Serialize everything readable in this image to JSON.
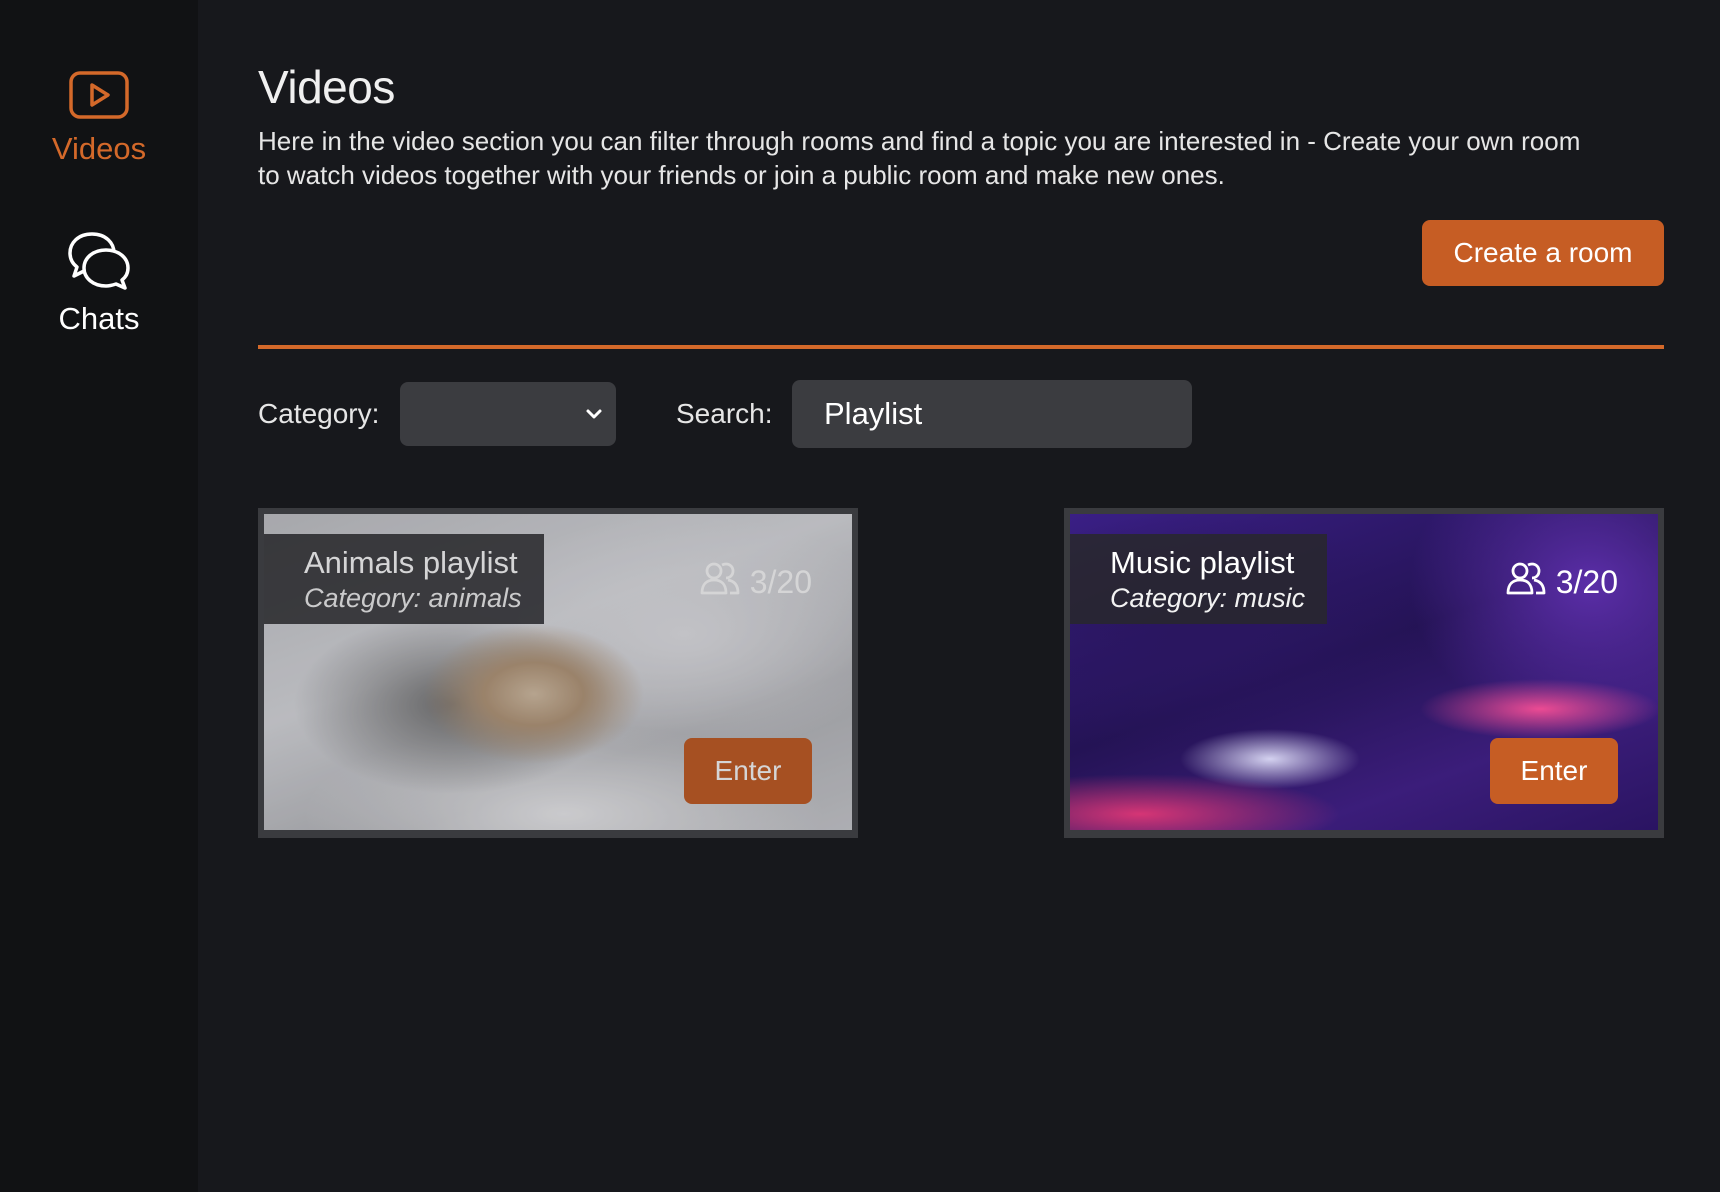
{
  "sidebar": {
    "items": [
      {
        "label": "Videos",
        "icon": "play-icon",
        "active": true
      },
      {
        "label": "Chats",
        "icon": "chat-bubbles-icon",
        "active": false
      }
    ]
  },
  "header": {
    "title": "Videos",
    "description": "Here in the video section you can filter through rooms and find a topic you are interested in - Create your own room to watch videos together with your friends or join a public room and make new ones.",
    "create_button": "Create a room"
  },
  "filters": {
    "category_label": "Category:",
    "category_value": "",
    "search_label": "Search:",
    "search_value": "Playlist"
  },
  "rooms": [
    {
      "title": "Animals playlist",
      "category": "Category: animals",
      "count": "3/20",
      "enter": "Enter"
    },
    {
      "title": "Music playlist",
      "category": "Category: music",
      "count": "3/20",
      "enter": "Enter"
    }
  ],
  "colors": {
    "accent": "#c65d24",
    "background": "#17181c",
    "sidebar": "#111214"
  }
}
